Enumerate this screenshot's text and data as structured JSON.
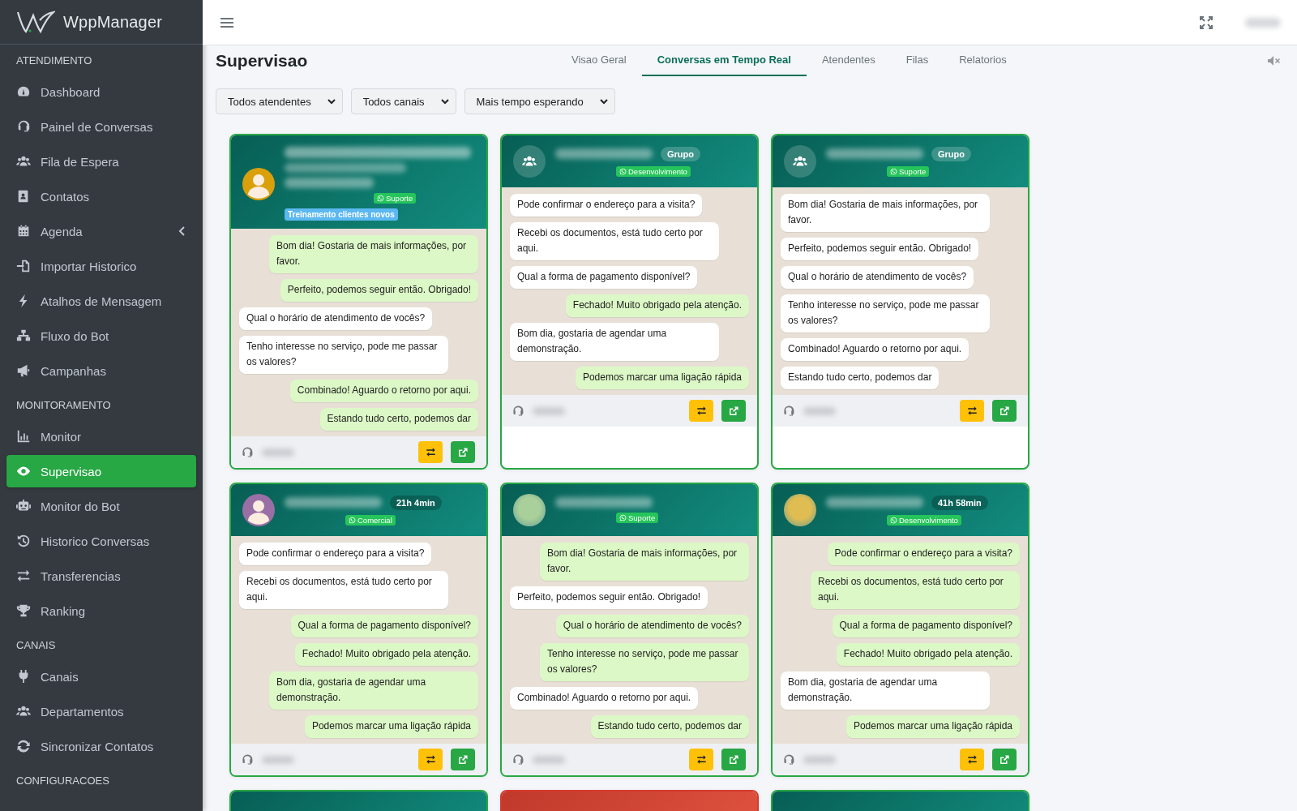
{
  "brand": "**Wpp**Manager",
  "sidebar": {
    "sections": [
      {
        "title": "ATENDIMENTO",
        "items": [
          {
            "label": "Dashboard",
            "selected": false
          },
          {
            "label": "Painel de Conversas",
            "selected": false
          },
          {
            "label": "Fila de Espera",
            "selected": false
          },
          {
            "label": "Contatos",
            "selected": false
          },
          {
            "label": "Agenda",
            "selected": false,
            "expanded": false
          },
          {
            "label": "Importar Historico",
            "selected": false
          },
          {
            "label": "Atalhos de Mensagem",
            "selected": false
          },
          {
            "label": "Fluxo do Bot",
            "selected": false
          },
          {
            "label": "Campanhas",
            "selected": false
          }
        ]
      },
      {
        "title": "MONITORAMENTO",
        "items": [
          {
            "label": "Monitor",
            "selected": false
          },
          {
            "label": "Supervisao",
            "selected": true
          },
          {
            "label": "Monitor do Bot",
            "selected": false
          },
          {
            "label": "Historico Conversas",
            "selected": false
          },
          {
            "label": "Transferencias",
            "selected": false
          },
          {
            "label": "Ranking",
            "selected": false
          }
        ]
      },
      {
        "title": "CANAIS",
        "items": [
          {
            "label": "Canais",
            "selected": false
          },
          {
            "label": "Departamentos",
            "selected": false
          },
          {
            "label": "Sincronizar Contatos",
            "selected": false
          }
        ]
      },
      {
        "title": "CONFIGURACOES"
      }
    ]
  },
  "page": {
    "title": "Supervisao",
    "muted": true
  },
  "tabs": [
    {
      "label": "Visao Geral",
      "selected": false
    },
    {
      "label": "Conversas em Tempo Real",
      "selected": true
    },
    {
      "label": "Atendentes",
      "selected": false
    },
    {
      "label": "Filas",
      "selected": false
    },
    {
      "label": "Relatorios",
      "selected": false
    }
  ],
  "filters": [
    {
      "value": "Todos atendentes"
    },
    {
      "value": "Todos canais"
    },
    {
      "value": "Mais tempo esperando"
    }
  ],
  "cards": [
    {
      "urgent": false,
      "avatar": {
        "kind": "person",
        "color": "#d9a00c"
      },
      "channel": "Suporte",
      "label": "Treinamento clientes novos",
      "messages": [
        {
          "kind": "out",
          "text": "Bom dia! Gostaria de mais informações, por favor."
        },
        {
          "kind": "out",
          "text": "Perfeito, podemos seguir então. Obrigado!"
        },
        {
          "kind": "in",
          "text": "Qual o horário de atendimento de vocês?"
        },
        {
          "kind": "in",
          "text": "Tenho interesse no serviço, pode me passar os valores?"
        },
        {
          "kind": "out",
          "text": "Combinado! Aguardo o retorno por aqui."
        },
        {
          "kind": "out",
          "text": "Estando tudo certo, podemos dar"
        }
      ]
    },
    {
      "urgent": false,
      "avatar": {
        "kind": "group"
      },
      "badge": "Grupo",
      "channel": "Desenvolvimento",
      "messages": [
        {
          "kind": "in",
          "text": "Pode confirmar o endereço para a visita?"
        },
        {
          "kind": "in",
          "text": "Recebi os documentos, está tudo certo por aqui."
        },
        {
          "kind": "in",
          "text": "Qual a forma de pagamento disponível?"
        },
        {
          "kind": "out",
          "text": "Fechado! Muito obrigado pela atenção."
        },
        {
          "kind": "in",
          "text": "Bom dia, gostaria de agendar uma demonstração."
        },
        {
          "kind": "out",
          "text": "Podemos marcar uma ligação rápida"
        }
      ]
    },
    {
      "urgent": false,
      "avatar": {
        "kind": "group"
      },
      "badge": "Grupo",
      "channel": "Suporte",
      "messages": [
        {
          "kind": "in",
          "text": "Bom dia! Gostaria de mais informações, por favor."
        },
        {
          "kind": "in",
          "text": "Perfeito, podemos seguir então. Obrigado!"
        },
        {
          "kind": "in",
          "text": "Qual o horário de atendimento de vocês?"
        },
        {
          "kind": "in",
          "text": "Tenho interesse no serviço, pode me passar os valores?"
        },
        {
          "kind": "in",
          "text": "Combinado! Aguardo o retorno por aqui."
        },
        {
          "kind": "in",
          "text": "Estando tudo certo, podemos dar"
        }
      ]
    },
    {
      "urgent": false,
      "avatar": {
        "kind": "person",
        "color": "#9a6fa5"
      },
      "badge": "21h 4min",
      "channel": "Comercial",
      "messages": [
        {
          "kind": "in",
          "text": "Pode confirmar o endereço para a visita?"
        },
        {
          "kind": "in",
          "text": "Recebi os documentos, está tudo certo por aqui."
        },
        {
          "kind": "out",
          "text": "Qual a forma de pagamento disponível?"
        },
        {
          "kind": "out",
          "text": "Fechado! Muito obrigado pela atenção."
        },
        {
          "kind": "out",
          "text": "Bom dia, gostaria de agendar uma demonstração."
        },
        {
          "kind": "out",
          "text": "Podemos marcar uma ligação rápida"
        }
      ]
    },
    {
      "urgent": false,
      "avatar": {
        "kind": "photo",
        "color": "#a9cf9a"
      },
      "channel": "Suporte",
      "messages": [
        {
          "kind": "out",
          "text": "Bom dia! Gostaria de mais informações, por favor."
        },
        {
          "kind": "in",
          "text": "Perfeito, podemos seguir então. Obrigado!"
        },
        {
          "kind": "out",
          "text": "Qual o horário de atendimento de vocês?"
        },
        {
          "kind": "out",
          "text": "Tenho interesse no serviço, pode me passar os valores?"
        },
        {
          "kind": "in",
          "text": "Combinado! Aguardo o retorno por aqui."
        },
        {
          "kind": "out",
          "text": "Estando tudo certo, podemos dar"
        }
      ]
    },
    {
      "urgent": false,
      "avatar": {
        "kind": "photo",
        "color": "#e0bd52"
      },
      "badge": "41h 58min",
      "channel": "Desenvolvimento",
      "messages": [
        {
          "kind": "out",
          "text": "Pode confirmar o endereço para a visita?"
        },
        {
          "kind": "out",
          "text": "Recebi os documentos, está tudo certo por aqui."
        },
        {
          "kind": "out",
          "text": "Qual a forma de pagamento disponível?"
        },
        {
          "kind": "out",
          "text": "Fechado! Muito obrigado pela atenção."
        },
        {
          "kind": "in",
          "text": "Bom dia, gostaria de agendar uma demonstração."
        },
        {
          "kind": "out",
          "text": "Podemos marcar uma ligação rápida"
        }
      ]
    },
    {
      "urgent": false
    },
    {
      "urgent": true
    },
    {
      "urgent": false
    }
  ]
}
